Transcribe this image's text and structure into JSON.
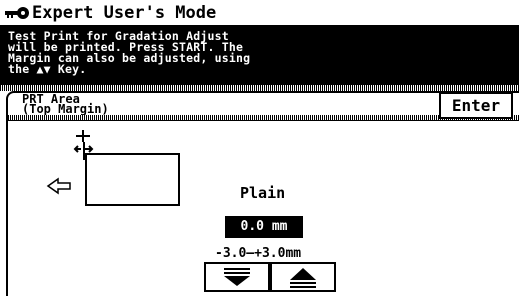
{
  "titlebar": {
    "icon": "key-icon",
    "title": "Expert User's Mode"
  },
  "message": {
    "lines": [
      "Test Print for Gradation Adjust",
      "will be printed. Press START. The",
      "Margin can also be adjusted, using",
      "the ▲▼ Key."
    ]
  },
  "header": {
    "line1": "PRT Area",
    "line2": "(Top Margin)",
    "enter_label": "Enter"
  },
  "main": {
    "diagram_icons": [
      "arrow-left-icon",
      "margin-adjust-icon",
      "paper-frame-icon"
    ],
    "paper_type": "Plain",
    "value": "0.0 mm",
    "range": "-3.0—+3.0mm",
    "down_button_icon": "arrow-down-icon",
    "up_button_icon": "arrow-up-icon"
  }
}
